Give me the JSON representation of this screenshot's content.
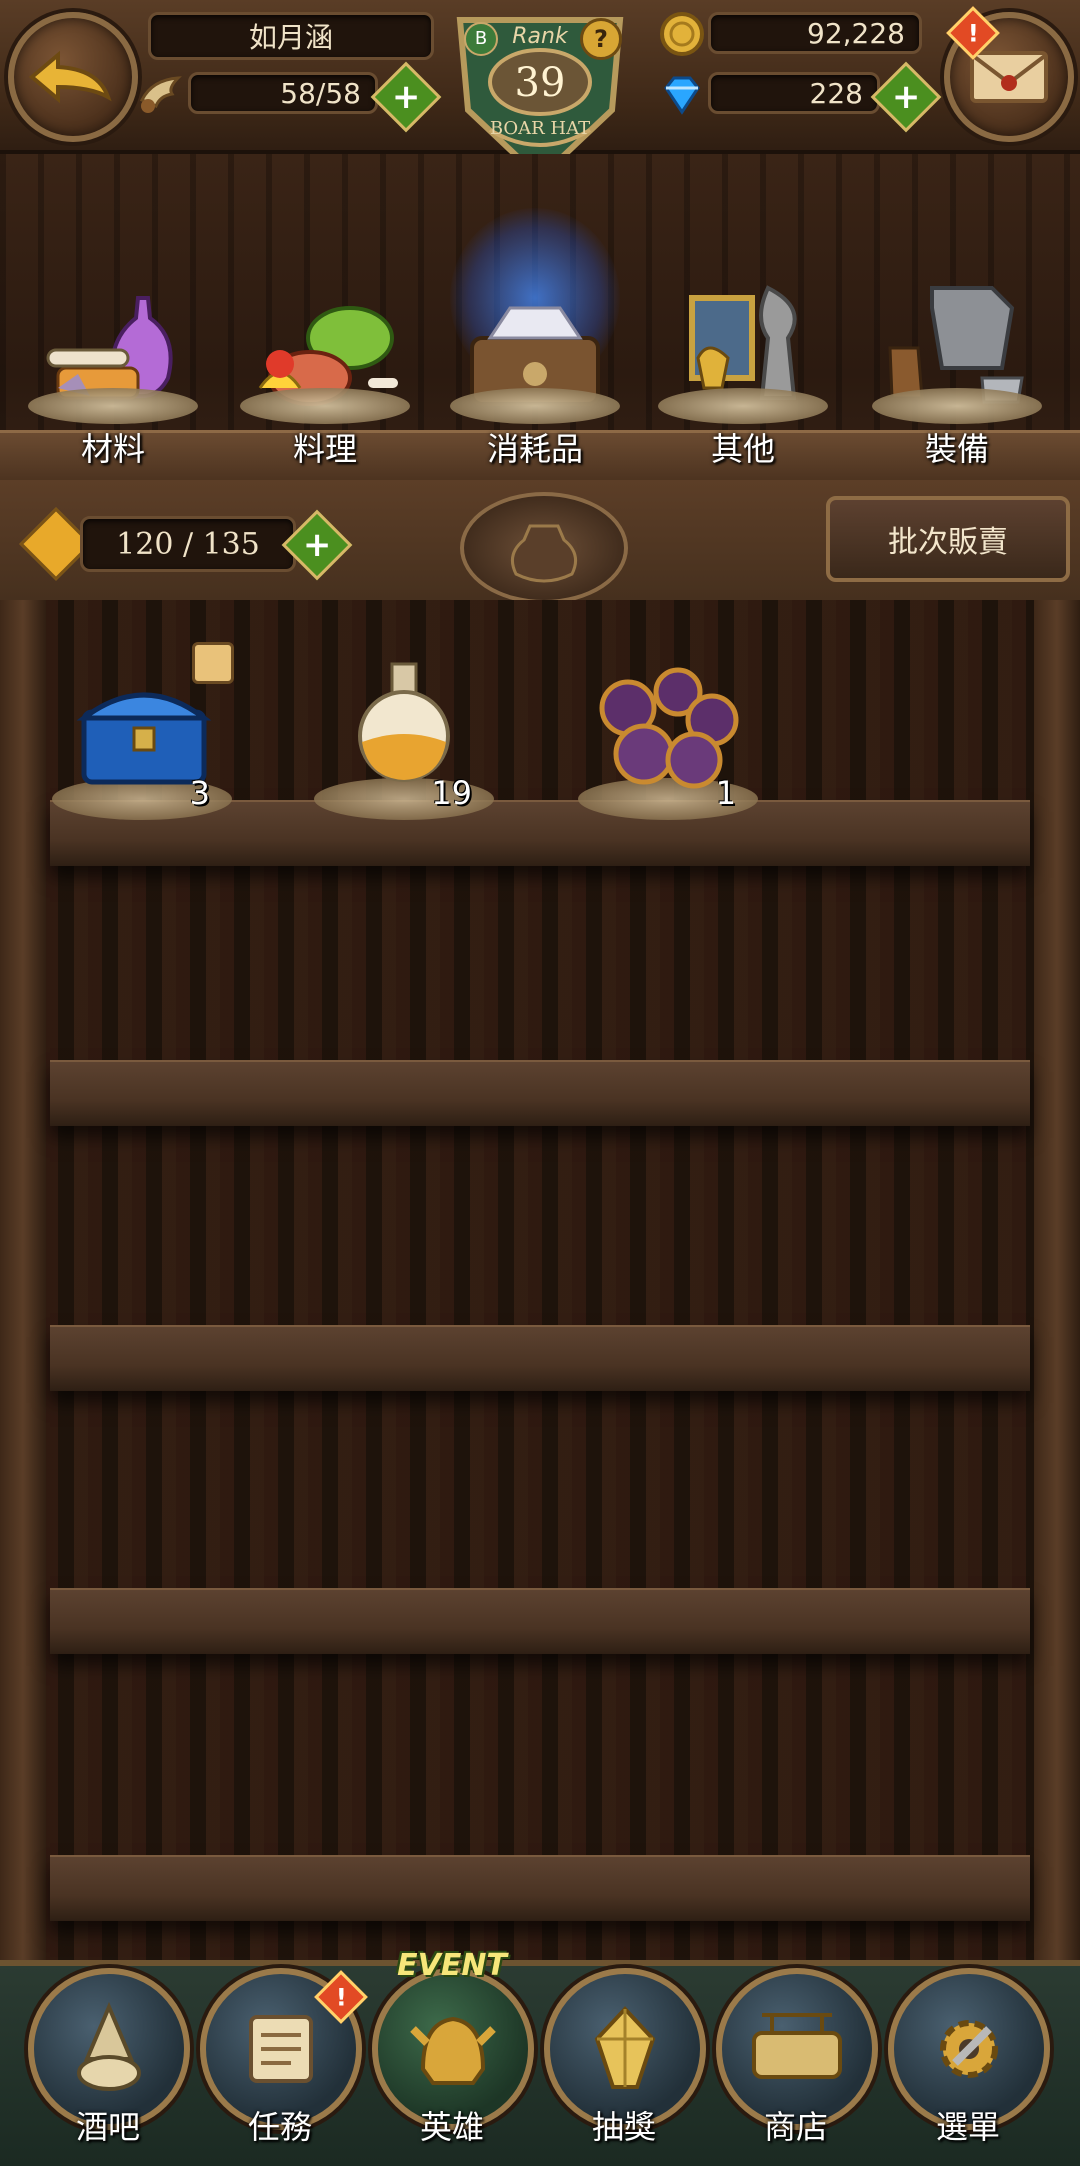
{
  "hud": {
    "player_name": "如月涵",
    "stamina": "58/58",
    "rank_label": "Rank",
    "rank_value": "39",
    "rank_title": "BOAR HAT",
    "rank_badge_small": "B",
    "help_mark": "?",
    "gold": "92,228",
    "gems": "228",
    "alert_mark": "!"
  },
  "categories": [
    {
      "label": "材料",
      "icon": "materials-icon"
    },
    {
      "label": "料理",
      "icon": "food-icon"
    },
    {
      "label": "消耗品",
      "icon": "consumables-icon",
      "selected": true
    },
    {
      "label": "其他",
      "icon": "misc-icon"
    },
    {
      "label": "裝備",
      "icon": "equipment-icon"
    }
  ],
  "toolbar": {
    "capacity": "120 / 135",
    "batch_sell_label": "批次販賣"
  },
  "items": [
    {
      "name": "treasure-chest",
      "count": "3"
    },
    {
      "name": "potion",
      "count": "19"
    },
    {
      "name": "gear-orbs",
      "count": "1"
    }
  ],
  "nav": [
    {
      "label": "酒吧",
      "icon": "tavern-icon"
    },
    {
      "label": "任務",
      "icon": "quest-scroll-icon",
      "alert": true
    },
    {
      "label": "英雄",
      "icon": "hero-helmet-icon",
      "badge": "EVENT"
    },
    {
      "label": "抽獎",
      "icon": "gacha-crystal-icon"
    },
    {
      "label": "商店",
      "icon": "shop-sign-icon"
    },
    {
      "label": "選單",
      "icon": "menu-gear-icon"
    }
  ],
  "colors": {
    "wood": "#4a3020",
    "gold_text": "#f0e3c8",
    "plus_green": "#4b8f1f",
    "alert_red": "#e24a24",
    "selected_glow": "#3a7bff"
  }
}
